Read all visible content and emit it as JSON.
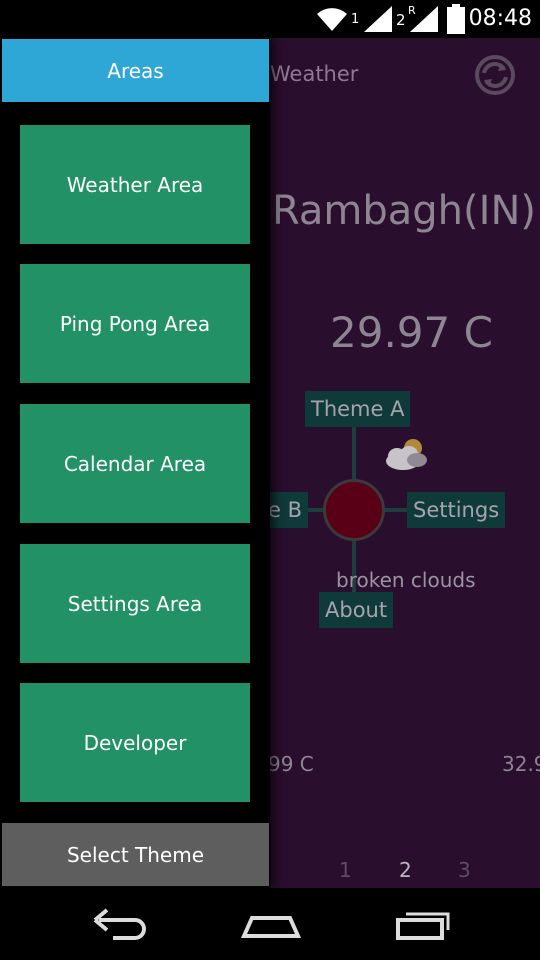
{
  "status_bar": {
    "time": "08:48",
    "sim1_label": "1",
    "sim2_label": "2",
    "roaming_label": "R",
    "icons": [
      "wifi-icon",
      "signal-icon",
      "battery-icon"
    ]
  },
  "app": {
    "title": "Weather",
    "city": "Rambagh(IN)",
    "temperature": "29.97 C",
    "description": "broken clouds",
    "menu": {
      "top": "Theme A",
      "left": "e B",
      "right": "Settings",
      "bottom": "About"
    },
    "forecast_left": "99 C",
    "forecast_right": "32.9",
    "pages": [
      "1",
      "2",
      "3"
    ],
    "active_page": "2",
    "colors": {
      "background": "#2a0e2e",
      "chip": "#0f3a3a",
      "center": "#5a0016"
    }
  },
  "drawer": {
    "header": "Areas",
    "items": [
      {
        "label": "Weather Area"
      },
      {
        "label": "Ping Pong Area"
      },
      {
        "label": "Calendar Area"
      },
      {
        "label": "Settings Area"
      },
      {
        "label": "Developer"
      }
    ],
    "footer": "Select Theme",
    "colors": {
      "header": "#2fa7d6",
      "item": "#229166",
      "footer": "#5e5e5e"
    }
  },
  "nav_bar": {
    "icons": [
      "back-icon",
      "home-icon",
      "recent-apps-icon"
    ]
  }
}
